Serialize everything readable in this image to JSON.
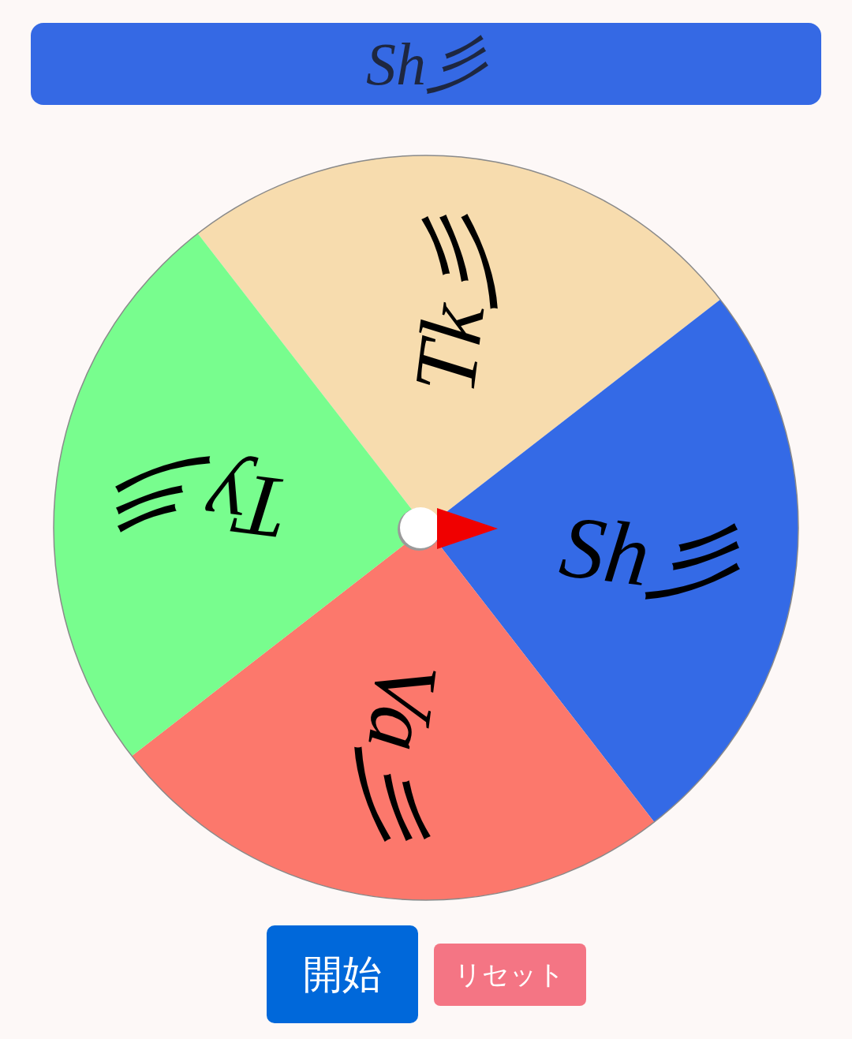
{
  "result_bar": {
    "text": "Sh彡"
  },
  "wheel": {
    "segments": [
      {
        "label": "Tk彡",
        "color": "#f7dcae"
      },
      {
        "label": "Sh彡",
        "color": "#346ae6"
      },
      {
        "label": "Va彡",
        "color": "#fc786c"
      },
      {
        "label": "Ty彡",
        "color": "#78fd8e"
      }
    ]
  },
  "buttons": [
    {
      "label": "開始",
      "kind": "primary"
    },
    {
      "label": "リセット",
      "kind": "secondary"
    }
  ]
}
